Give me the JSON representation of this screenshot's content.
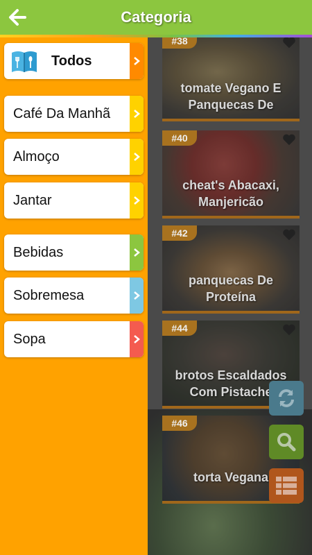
{
  "header": {
    "title": "Categoria"
  },
  "menu": {
    "all": {
      "label": "Todos",
      "accent": "#ff8a00"
    },
    "items": [
      {
        "label": "Café Da Manhã",
        "accent": "#ffd200"
      },
      {
        "label": "Almoço",
        "accent": "#ffd200"
      },
      {
        "label": "Jantar",
        "accent": "#ffd200"
      },
      {
        "label": "Bebidas",
        "accent": "#8cc63f"
      },
      {
        "label": "Sobremesa",
        "accent": "#7ec8e3"
      },
      {
        "label": "Sopa",
        "accent": "#f45b4f"
      }
    ]
  },
  "recipes": [
    {
      "num": "#38",
      "title_line1": "tomate Vegano E",
      "title_line2": "Panquecas De"
    },
    {
      "num": "#40",
      "title_line1": "cheat's Abacaxi,",
      "title_line2": "Manjericão"
    },
    {
      "num": "#42",
      "title_line1": "panquecas De",
      "title_line2": "Proteína"
    },
    {
      "num": "#44",
      "title_line1": "brotos Escaldados",
      "title_line2": "Com Pistache"
    },
    {
      "num": "#46",
      "title_line1": "torta Vegana",
      "title_line2": ""
    }
  ],
  "colors": {
    "header": "#8cc63f",
    "drawer": "#ffa200",
    "badge": "#a8721f"
  },
  "icons": {
    "back": "arrow-left-icon",
    "refresh": "refresh-icon",
    "search": "search-icon",
    "list": "list-icon",
    "favorite": "heart-icon",
    "book": "book-icon"
  }
}
